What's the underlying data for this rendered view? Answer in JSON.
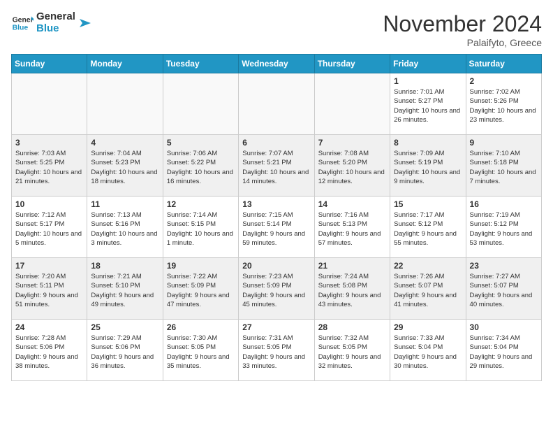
{
  "header": {
    "logo_line1": "General",
    "logo_line2": "Blue",
    "month": "November 2024",
    "location": "Palaifyto, Greece"
  },
  "weekdays": [
    "Sunday",
    "Monday",
    "Tuesday",
    "Wednesday",
    "Thursday",
    "Friday",
    "Saturday"
  ],
  "weeks": [
    [
      {
        "day": "",
        "info": ""
      },
      {
        "day": "",
        "info": ""
      },
      {
        "day": "",
        "info": ""
      },
      {
        "day": "",
        "info": ""
      },
      {
        "day": "",
        "info": ""
      },
      {
        "day": "1",
        "info": "Sunrise: 7:01 AM\nSunset: 5:27 PM\nDaylight: 10 hours and 26 minutes."
      },
      {
        "day": "2",
        "info": "Sunrise: 7:02 AM\nSunset: 5:26 PM\nDaylight: 10 hours and 23 minutes."
      }
    ],
    [
      {
        "day": "3",
        "info": "Sunrise: 7:03 AM\nSunset: 5:25 PM\nDaylight: 10 hours and 21 minutes."
      },
      {
        "day": "4",
        "info": "Sunrise: 7:04 AM\nSunset: 5:23 PM\nDaylight: 10 hours and 18 minutes."
      },
      {
        "day": "5",
        "info": "Sunrise: 7:06 AM\nSunset: 5:22 PM\nDaylight: 10 hours and 16 minutes."
      },
      {
        "day": "6",
        "info": "Sunrise: 7:07 AM\nSunset: 5:21 PM\nDaylight: 10 hours and 14 minutes."
      },
      {
        "day": "7",
        "info": "Sunrise: 7:08 AM\nSunset: 5:20 PM\nDaylight: 10 hours and 12 minutes."
      },
      {
        "day": "8",
        "info": "Sunrise: 7:09 AM\nSunset: 5:19 PM\nDaylight: 10 hours and 9 minutes."
      },
      {
        "day": "9",
        "info": "Sunrise: 7:10 AM\nSunset: 5:18 PM\nDaylight: 10 hours and 7 minutes."
      }
    ],
    [
      {
        "day": "10",
        "info": "Sunrise: 7:12 AM\nSunset: 5:17 PM\nDaylight: 10 hours and 5 minutes."
      },
      {
        "day": "11",
        "info": "Sunrise: 7:13 AM\nSunset: 5:16 PM\nDaylight: 10 hours and 3 minutes."
      },
      {
        "day": "12",
        "info": "Sunrise: 7:14 AM\nSunset: 5:15 PM\nDaylight: 10 hours and 1 minute."
      },
      {
        "day": "13",
        "info": "Sunrise: 7:15 AM\nSunset: 5:14 PM\nDaylight: 9 hours and 59 minutes."
      },
      {
        "day": "14",
        "info": "Sunrise: 7:16 AM\nSunset: 5:13 PM\nDaylight: 9 hours and 57 minutes."
      },
      {
        "day": "15",
        "info": "Sunrise: 7:17 AM\nSunset: 5:12 PM\nDaylight: 9 hours and 55 minutes."
      },
      {
        "day": "16",
        "info": "Sunrise: 7:19 AM\nSunset: 5:12 PM\nDaylight: 9 hours and 53 minutes."
      }
    ],
    [
      {
        "day": "17",
        "info": "Sunrise: 7:20 AM\nSunset: 5:11 PM\nDaylight: 9 hours and 51 minutes."
      },
      {
        "day": "18",
        "info": "Sunrise: 7:21 AM\nSunset: 5:10 PM\nDaylight: 9 hours and 49 minutes."
      },
      {
        "day": "19",
        "info": "Sunrise: 7:22 AM\nSunset: 5:09 PM\nDaylight: 9 hours and 47 minutes."
      },
      {
        "day": "20",
        "info": "Sunrise: 7:23 AM\nSunset: 5:09 PM\nDaylight: 9 hours and 45 minutes."
      },
      {
        "day": "21",
        "info": "Sunrise: 7:24 AM\nSunset: 5:08 PM\nDaylight: 9 hours and 43 minutes."
      },
      {
        "day": "22",
        "info": "Sunrise: 7:26 AM\nSunset: 5:07 PM\nDaylight: 9 hours and 41 minutes."
      },
      {
        "day": "23",
        "info": "Sunrise: 7:27 AM\nSunset: 5:07 PM\nDaylight: 9 hours and 40 minutes."
      }
    ],
    [
      {
        "day": "24",
        "info": "Sunrise: 7:28 AM\nSunset: 5:06 PM\nDaylight: 9 hours and 38 minutes."
      },
      {
        "day": "25",
        "info": "Sunrise: 7:29 AM\nSunset: 5:06 PM\nDaylight: 9 hours and 36 minutes."
      },
      {
        "day": "26",
        "info": "Sunrise: 7:30 AM\nSunset: 5:05 PM\nDaylight: 9 hours and 35 minutes."
      },
      {
        "day": "27",
        "info": "Sunrise: 7:31 AM\nSunset: 5:05 PM\nDaylight: 9 hours and 33 minutes."
      },
      {
        "day": "28",
        "info": "Sunrise: 7:32 AM\nSunset: 5:05 PM\nDaylight: 9 hours and 32 minutes."
      },
      {
        "day": "29",
        "info": "Sunrise: 7:33 AM\nSunset: 5:04 PM\nDaylight: 9 hours and 30 minutes."
      },
      {
        "day": "30",
        "info": "Sunrise: 7:34 AM\nSunset: 5:04 PM\nDaylight: 9 hours and 29 minutes."
      }
    ]
  ]
}
